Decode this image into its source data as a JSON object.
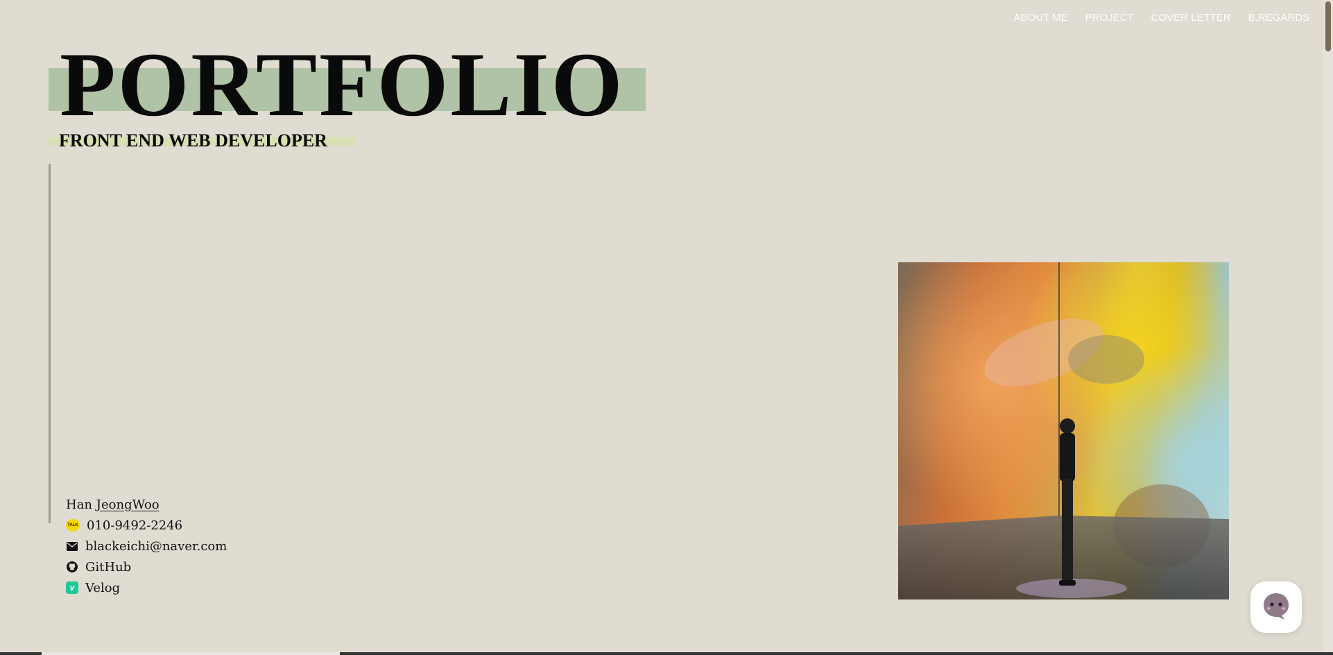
{
  "nav": {
    "items": [
      "ABOUT ME",
      "PROJECT",
      "COVER LETTER",
      "B.REGARDS"
    ]
  },
  "hero": {
    "title": "PORTFOLIO",
    "subtitle": "FRONT END WEB DEVELOPER"
  },
  "contact": {
    "name_first": "Han",
    "name_last": "JeongWoo",
    "phone": "010-9492-2246",
    "email": "blackeichi@naver.com",
    "github": "GitHub",
    "velog": "Velog",
    "talk_icon_text": "TALK",
    "velog_icon_text": "v"
  },
  "colors": {
    "background": "#e0dcd1",
    "title_highlight": "#b0c3a6",
    "subtitle_highlight": "#d8dfb2",
    "nav_text": "#ffffff"
  },
  "icons": [
    "kakaotalk-icon",
    "mail-icon",
    "github-icon",
    "velog-icon",
    "chat-icon"
  ]
}
